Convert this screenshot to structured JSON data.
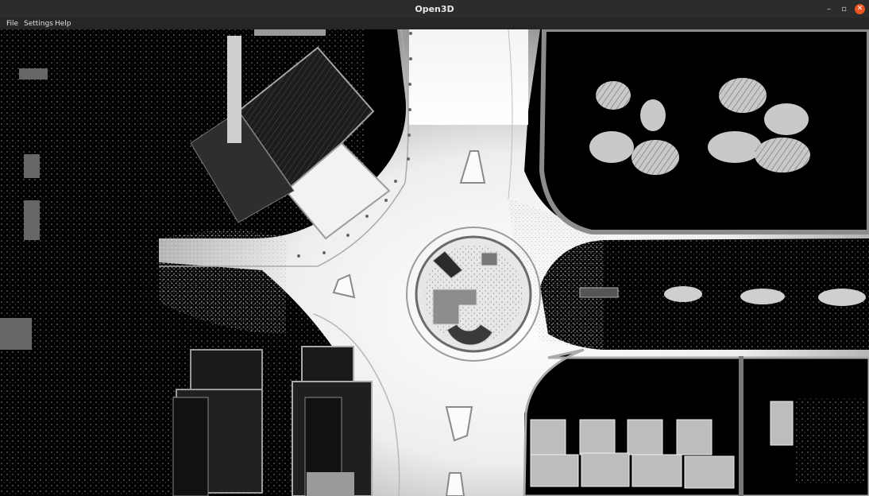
{
  "window": {
    "title": "Open3D",
    "controls": {
      "minimize": "–",
      "maximize": "▫",
      "close": "✕"
    },
    "accent_close": "#e95420"
  },
  "menubar": {
    "items": [
      "File",
      "Settings",
      "Help"
    ]
  },
  "viewport": {
    "content": "point-cloud-render",
    "background": "#000000"
  }
}
